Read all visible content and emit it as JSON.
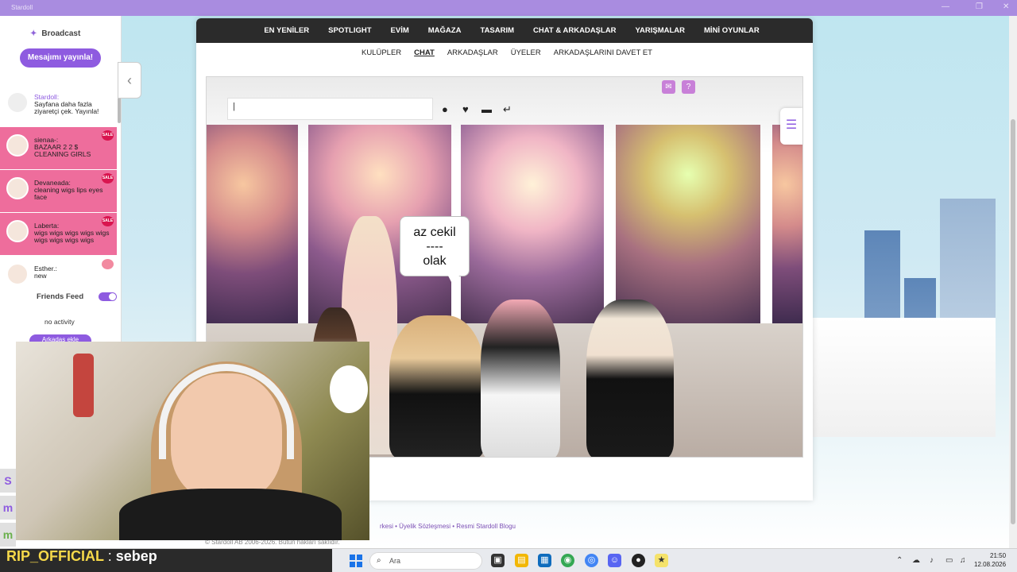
{
  "window": {
    "title": "Stardoll"
  },
  "sidebar": {
    "broadcast_title": "Broadcast",
    "publish_button": "Mesajımı yayınla!",
    "feed": [
      {
        "name": "Stardoll:",
        "message": "Sayfana daha fazla ziyaretçi çek. Yayınla!",
        "style": "first"
      },
      {
        "name": "sienaa-:",
        "message": "BAZAAR 2 2 $ CLEANING GIRLS",
        "style": "pink",
        "badge": "SALE"
      },
      {
        "name": "Devaneada:",
        "message": "cleaning wigs lips eyes face",
        "style": "pink",
        "badge": "SALE"
      },
      {
        "name": "Laberta:",
        "message": "wigs wigs wigs wigs wigs wigs wigs wigs wigs",
        "style": "pink",
        "badge": "SALE"
      },
      {
        "name": "Esther.:",
        "message": "new",
        "style": "cream"
      }
    ],
    "friends_feed_label": "Friends Feed",
    "no_activity": "no activity",
    "bottom_button": "Arkadaş ekle"
  },
  "nav": {
    "main": [
      "EN YENİLER",
      "SPOTLIGHT",
      "EVİM",
      "MAĞAZA",
      "TASARIM",
      "CHAT & ARKADAŞLAR",
      "YARIŞMALAR",
      "MİNİ OYUNLAR"
    ],
    "sub": [
      "KULÜPLER",
      "CHAT",
      "ARKADAŞLAR",
      "ÜYELER",
      "ARKADAŞLARINI DAVET ET"
    ],
    "active_sub": "CHAT"
  },
  "chat": {
    "input_value": "|",
    "bubble_lines": [
      "az cekil",
      "----",
      "olak"
    ],
    "controls": [
      "speech-bubble-icon",
      "heart-icon",
      "emote-icon",
      "undo-arrow-icon"
    ]
  },
  "footer": {
    "links": "rkesi • Üyelik Sözleşmesi • Resmi Stardoll Blogu",
    "copyright": "© Stardoll AB 2006-2026. Bütün hakları saklıdır."
  },
  "stream_overlay": {
    "username": "RIP_OFFICIAL",
    "separator": ":",
    "message": "sebep"
  },
  "taskbar": {
    "search_placeholder": "Ara",
    "time": "21:50",
    "date": "12.08.2026"
  },
  "colors": {
    "accent": "#8e5be0",
    "nav_bg": "#2b2b2b",
    "feed_pink": "#ee6d9c",
    "title_bar": "#a98ce0"
  }
}
